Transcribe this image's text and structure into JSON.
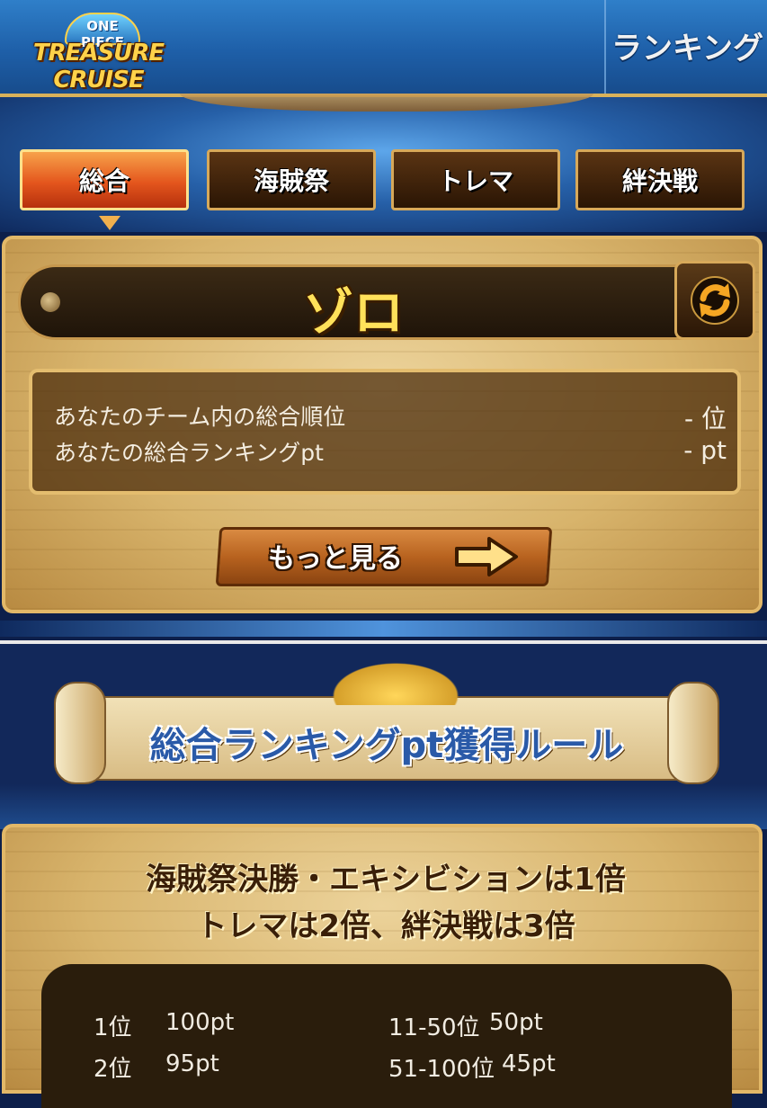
{
  "header": {
    "logo_top": "ONE PIECE",
    "logo_main": "TREASURE CRUISE",
    "title": "ランキング"
  },
  "tabs": [
    {
      "label": "総合",
      "active": true
    },
    {
      "label": "海賊祭",
      "active": false
    },
    {
      "label": "トレマ",
      "active": false
    },
    {
      "label": "絆決戦",
      "active": false
    }
  ],
  "team": {
    "name": "ゾロ"
  },
  "stats": {
    "rank_label": "あなたのチーム内の総合順位",
    "rank_value": "- 位",
    "pt_label": "あなたの総合ランキングpt",
    "pt_value": "- pt"
  },
  "more_button": {
    "label": "もっと見る"
  },
  "rules_banner": {
    "title": "総合ランキングpt獲得ルール"
  },
  "rules": {
    "line1": "海賊祭決勝・エキシビションは1倍",
    "line2": "トレマは2倍、絆決戦は3倍"
  },
  "points_table": [
    {
      "rank": "1位",
      "pt": "100pt",
      "rank2": "11-50位",
      "pt2": "50pt"
    },
    {
      "rank": "2位",
      "pt": "95pt",
      "rank2": "51-100位",
      "pt2": "45pt"
    }
  ],
  "colors": {
    "accent_orange": "#e4561d",
    "gold": "#e2b868",
    "header_blue": "#1e5fa8",
    "name_yellow": "#ffe15a"
  },
  "icons": [
    "refresh-icon",
    "arrow-right-icon",
    "scroll-icon",
    "treasure-icon"
  ]
}
